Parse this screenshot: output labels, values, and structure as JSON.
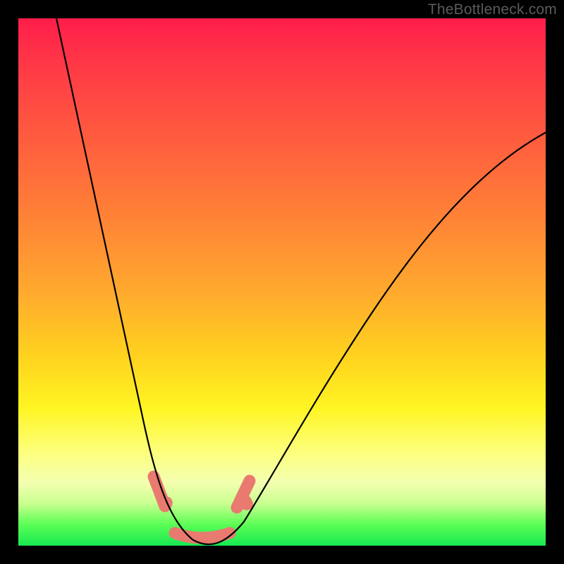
{
  "watermark": "TheBottleneck.com",
  "chart_data": {
    "type": "line",
    "title": "",
    "xlabel": "",
    "ylabel": "",
    "xlim": [
      0,
      100
    ],
    "ylim": [
      0,
      100
    ],
    "grid": false,
    "legend": false,
    "description": "Bottleneck magnitude curve over a red–yellow–green gradient; V-shaped curve with minimum near x≈33 at y≈0, rising steeply to left edge and more gradually to right edge.",
    "series": [
      {
        "name": "bottleneck-curve",
        "x": [
          8,
          12,
          16,
          20,
          24,
          26,
          28,
          30,
          32,
          34,
          36,
          38,
          42,
          48,
          56,
          66,
          78,
          90,
          100
        ],
        "y": [
          100,
          86,
          70,
          52,
          30,
          18,
          9,
          3,
          0,
          0,
          3,
          7,
          15,
          26,
          40,
          54,
          66,
          74,
          78
        ]
      }
    ],
    "highlight": {
      "name": "optimal-range",
      "x_range": [
        28,
        38
      ],
      "y": 0,
      "color": "#e97a6f"
    }
  }
}
